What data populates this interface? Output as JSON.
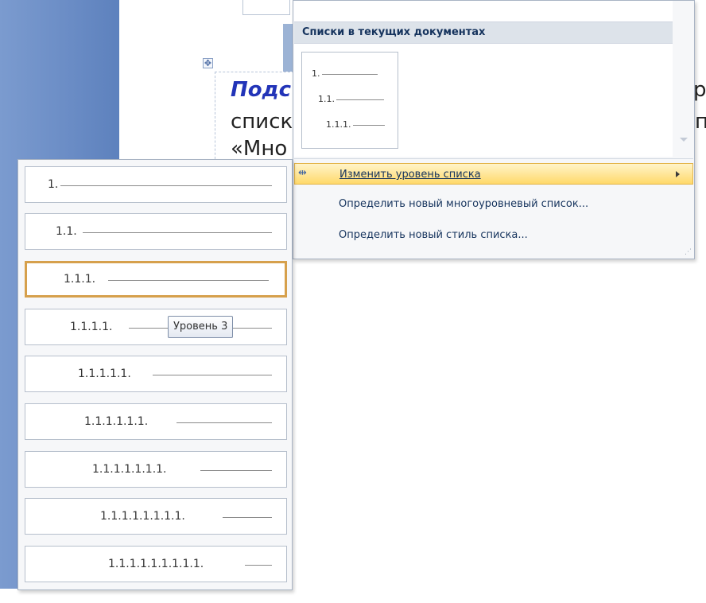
{
  "document": {
    "heading_fragment": "Подс",
    "line2_fragment": "списк",
    "line3_fragment": "«Мно",
    "right_fragment_1": "ро",
    "right_fragment_2": "п"
  },
  "panel": {
    "section_title": "Списки в текущих документах",
    "thumbnail_rows": [
      "1.",
      "1.1.",
      "1.1.1."
    ],
    "menu_items": [
      {
        "label": "Изменить уровень списка",
        "accesskey": "И",
        "icon": "change-level-icon",
        "active": true,
        "has_submenu": true
      },
      {
        "label": "Определить новый многоуровневый список...",
        "accesskey": "О",
        "active": false
      },
      {
        "label": "Определить новый стиль списка...",
        "accesskey": "О",
        "active": false
      }
    ]
  },
  "levels": {
    "items": [
      "1.",
      "1.1.",
      "1.1.1.",
      "1.1.1.1.",
      "1.1.1.1.1.",
      "1.1.1.1.1.1.",
      "1.1.1.1.1.1.1.",
      "1.1.1.1.1.1.1.1.",
      "1.1.1.1.1.1.1.1.1."
    ],
    "selected_index": 2,
    "tooltip": "Уровень 3"
  },
  "colors": {
    "sidebar_blue": "#6a8cc5",
    "heading_blue": "#2234b8",
    "highlight_gold": "#d6a04c",
    "menu_hover": "#ffd96b",
    "menu_text": "#15335d"
  }
}
